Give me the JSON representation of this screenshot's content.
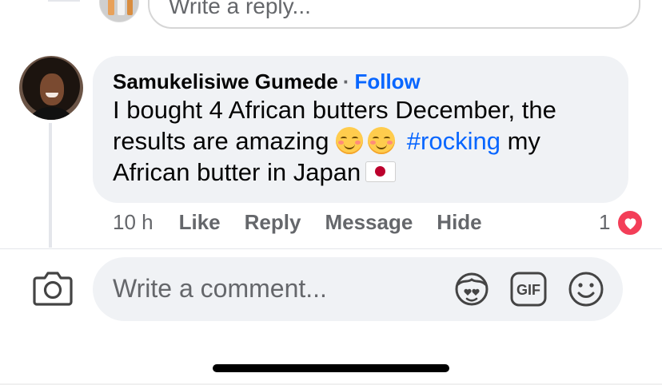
{
  "reply_row": {
    "placeholder": "Write a reply..."
  },
  "comment": {
    "author": "Samukelisiwe Gumede",
    "separator": "·",
    "follow_label": "Follow",
    "text_part1": "I bought 4 African butters December, the results are amazing",
    "emojis": [
      "smiling-face-emoji",
      "smiling-face-emoji"
    ],
    "hashtag": "#rocking",
    "text_part2": "my African butter in Japan",
    "flag_emoji": "japan-flag-emoji",
    "time": "10 h",
    "actions": [
      "Like",
      "Reply",
      "Message",
      "Hide"
    ],
    "reaction_count": "1",
    "reaction_type": "heart-icon"
  },
  "composer": {
    "placeholder": "Write a comment...",
    "icons": [
      "camera-icon",
      "sticker-icon",
      "gif-icon",
      "emoji-icon"
    ]
  },
  "colors": {
    "link": "#0866ff",
    "bubble": "#f0f2f5",
    "muted": "#65676b",
    "heart": "#f33e58"
  }
}
